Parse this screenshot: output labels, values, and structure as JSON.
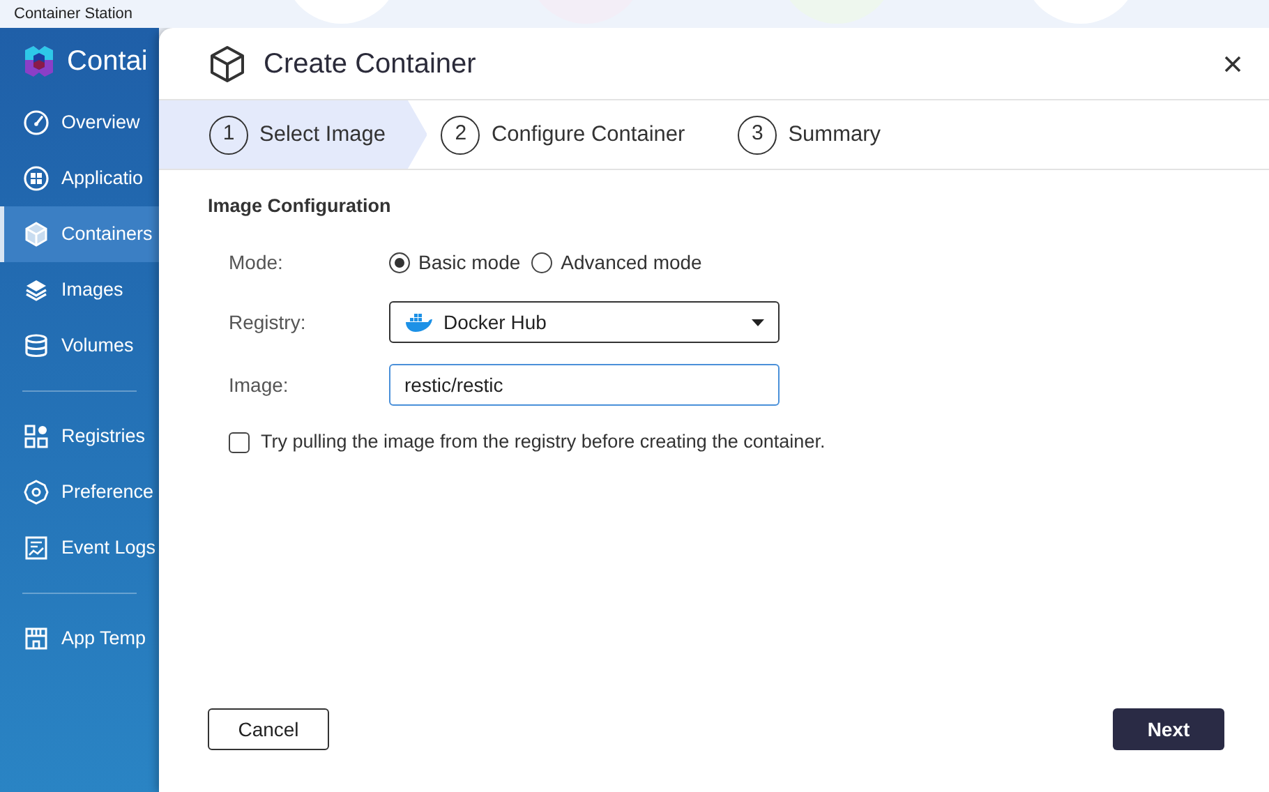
{
  "app_bar": {
    "title": "Container Station"
  },
  "sidebar": {
    "brand": "Contai",
    "groups": [
      [
        {
          "label": "Overview",
          "kind": "gauge",
          "selected": false
        },
        {
          "label": "Applicatio",
          "kind": "grid",
          "selected": false
        },
        {
          "label": "Containers",
          "kind": "cube",
          "selected": true
        },
        {
          "label": "Images",
          "kind": "layers",
          "selected": false
        },
        {
          "label": "Volumes",
          "kind": "database",
          "selected": false
        }
      ],
      [
        {
          "label": "Registries",
          "kind": "registry",
          "selected": false
        },
        {
          "label": "Preference",
          "kind": "gear",
          "selected": false
        },
        {
          "label": "Event Logs",
          "kind": "log",
          "selected": false
        }
      ],
      [
        {
          "label": "App Temp",
          "kind": "store",
          "selected": false
        }
      ]
    ]
  },
  "dialog": {
    "title": "Create Container",
    "steps": [
      {
        "number": "1",
        "label": "Select Image",
        "selected": true
      },
      {
        "number": "2",
        "label": "Configure Container",
        "selected": false
      },
      {
        "number": "3",
        "label": "Summary",
        "selected": false
      }
    ],
    "section_title": "Image Configuration",
    "mode": {
      "label": "Mode:",
      "options": [
        {
          "label": "Basic mode",
          "selected": true
        },
        {
          "label": "Advanced mode",
          "selected": false
        }
      ]
    },
    "registry": {
      "label": "Registry:",
      "value": "Docker Hub"
    },
    "image": {
      "label": "Image:",
      "value": "restic/restic"
    },
    "pull_option": {
      "label": "Try pulling the image from the registry before creating the container.",
      "checked": false
    },
    "buttons": {
      "cancel": "Cancel",
      "next": "Next"
    }
  }
}
